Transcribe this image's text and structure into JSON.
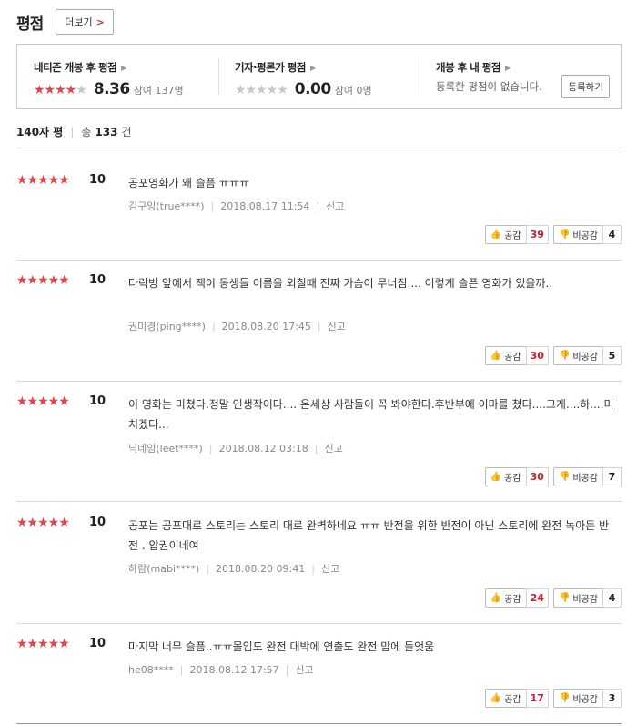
{
  "header": {
    "title": "평점",
    "more_label": "더보기"
  },
  "summary": {
    "netizen": {
      "title": "네티즌 개봉 후 평점",
      "score": "8.36",
      "count": "참여 137명",
      "stars_on": "★★★★",
      "stars_off": "★"
    },
    "critic": {
      "title": "기자·평론가 평점",
      "score": "0.00",
      "count": "참여 0명",
      "stars_on": "",
      "stars_off": "★★★★★"
    },
    "mine": {
      "title": "개봉 후 내 평점",
      "empty_text": "등록한 평점이 없습니다.",
      "register_label": "등록하기"
    }
  },
  "list_header": {
    "label": "140자 평",
    "total_prefix": "총",
    "total": "133",
    "total_suffix": "건"
  },
  "vote_labels": {
    "like": "공감",
    "dislike": "비공감"
  },
  "reviews": [
    {
      "stars": "★★★★★",
      "score": "10",
      "text": "공포영화가 왜 슬픔 ㅠㅠㅠ",
      "author": "김구잉(true****)",
      "date": "2018.08.17 11:54",
      "report": "신고",
      "likes": "39",
      "dislikes": "4"
    },
    {
      "stars": "★★★★★",
      "score": "10",
      "text": "다락방 앞에서 잭이 동생들 이름을 외칠때 진짜 가슴이 무너짐.... 이렇게 슬픈 영화가 있을까..",
      "author": "권미경(ping****)",
      "date": "2018.08.20 17:45",
      "report": "신고",
      "likes": "30",
      "dislikes": "5"
    },
    {
      "stars": "★★★★★",
      "score": "10",
      "text": "이 영화는 미쳤다.정말 인생작이다.... 온세상 사람들이 꼭 봐야한다.후반부에 이마를 쳤다....그게....하....미치겠다...",
      "author": "닉네임(leet****)",
      "date": "2018.08.12 03:18",
      "report": "신고",
      "likes": "30",
      "dislikes": "7"
    },
    {
      "stars": "★★★★★",
      "score": "10",
      "text": "공포는 공포대로 스토리는 스토리 대로 완벽하네요 ㅠㅠ 반전을 위한 반전이 아닌 스토리에 완전 녹아든 반전 . 압권이네여",
      "author": "하람(mabi****)",
      "date": "2018.08.20 09:41",
      "report": "신고",
      "likes": "24",
      "dislikes": "4"
    },
    {
      "stars": "★★★★★",
      "score": "10",
      "text": "마지막 너무 슬픔..ㅠㅠ몰입도 완전 대박에 연출도 완전 맘에 들엇움",
      "author": "he08****",
      "date": "2018.08.12 17:57",
      "report": "신고",
      "likes": "17",
      "dislikes": "3"
    }
  ]
}
